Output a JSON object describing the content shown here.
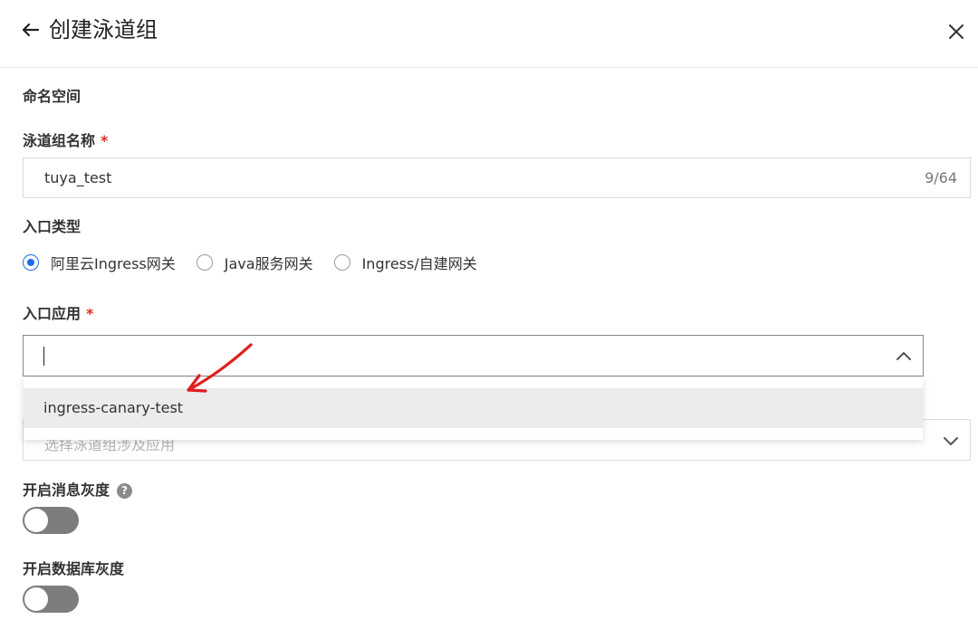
{
  "header": {
    "title": "创建泳道组"
  },
  "form": {
    "namespace_label": "命名空间",
    "group_name": {
      "label": "泳道组名称",
      "required_mark": "*",
      "value": "tuya_test",
      "counter": "9/64"
    },
    "entry_type": {
      "label": "入口类型",
      "options": [
        {
          "label": "阿里云Ingress网关",
          "checked": true
        },
        {
          "label": "Java服务网关",
          "checked": false
        },
        {
          "label": "Ingress/自建网关",
          "checked": false
        }
      ]
    },
    "entry_app": {
      "label": "入口应用",
      "required_mark": "*",
      "value": "",
      "open": true,
      "options": [
        "ingress-canary-test"
      ]
    },
    "involved_apps": {
      "placeholder": "选择泳道组涉及应用"
    },
    "message_gray": {
      "label": "开启消息灰度",
      "help_icon_text": "?",
      "enabled": false
    },
    "database_gray": {
      "label": "开启数据库灰度",
      "enabled": false
    }
  },
  "colors": {
    "accent": "#1a6fe0",
    "required": "#d93026",
    "annotation_arrow": "#e02020",
    "toggle_off": "#7d7d7d"
  }
}
